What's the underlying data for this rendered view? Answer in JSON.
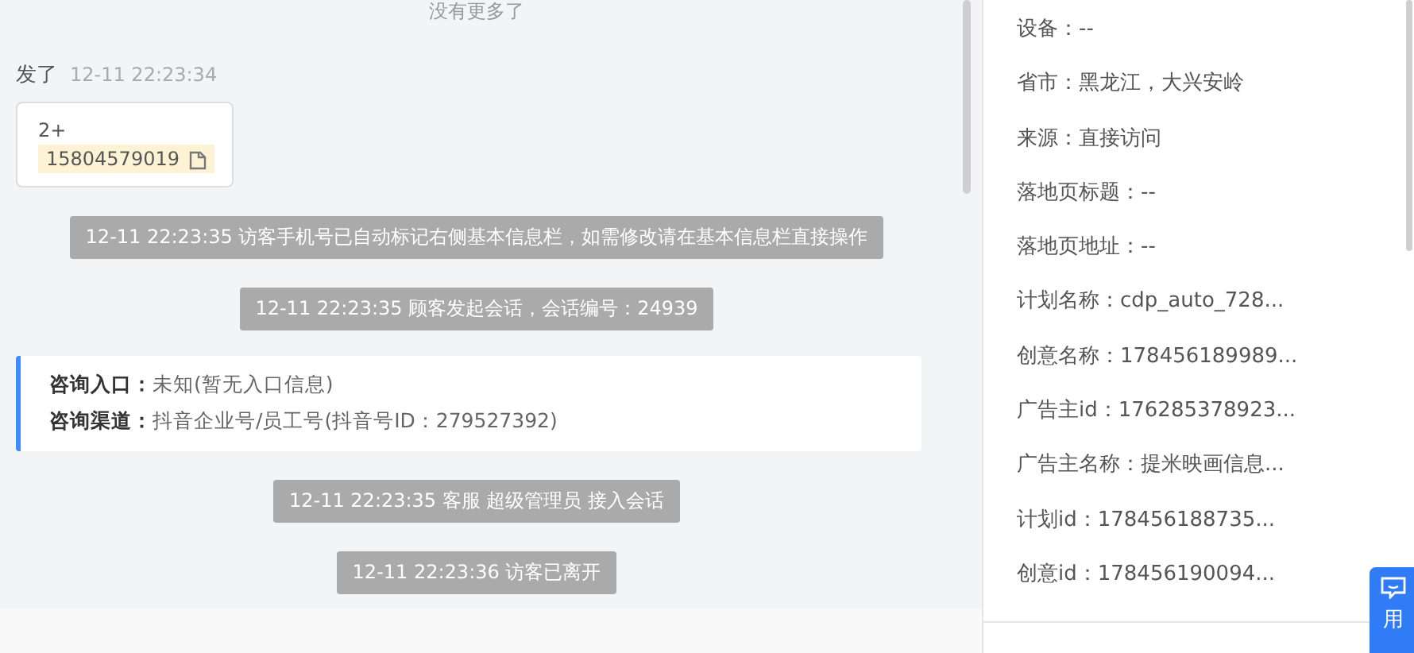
{
  "chat": {
    "no_more": "没有更多了",
    "message": {
      "sender": "发了",
      "time": "12-11 22:23:34",
      "line_1": "2+",
      "phone": "15804579019"
    },
    "notices_top": [
      "12-11 22:23:35 访客手机号已自动标记右侧基本信息栏，如需修改请在基本信息栏直接操作",
      "12-11 22:23:35 顾客发起会话，会话编号：24939"
    ],
    "info_card": [
      {
        "label": "咨询入口：",
        "value": "未知(暂无入口信息)"
      },
      {
        "label": "咨询渠道：",
        "value": "抖音企业号/员工号(抖音号ID：279527392)"
      }
    ],
    "notices_bottom": [
      "12-11 22:23:35 客服 超级管理员 接入会话",
      "12-11 22:23:36 访客已离开"
    ]
  },
  "info_panel": {
    "rows": [
      "设备：--",
      "省市：黑龙江，大兴安岭",
      "来源：直接访问",
      "落地页标题：--",
      "落地页地址：--",
      "计划名称：cdp_auto_728...",
      "创意名称：178456189989...",
      "广告主id：176285378923...",
      "广告主名称：提米映画信息...",
      "计划id：178456188735...",
      "创意id：178456190094..."
    ]
  },
  "float_button": {
    "label": "用"
  }
}
